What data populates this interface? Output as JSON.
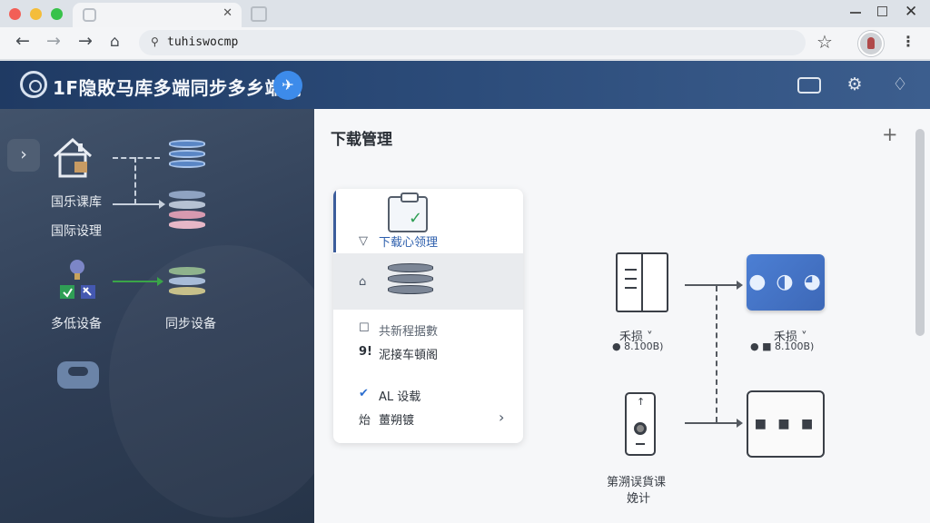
{
  "browser": {
    "url": "tuhiswocmp",
    "tab_close": "✕",
    "window_close": "✕"
  },
  "app": {
    "title": "1F隐敗马库多端同步多乡端同"
  },
  "sidebar": {
    "item1_label_a": "国乐课库",
    "item1_label_b": "国际设理",
    "item2_label": "多低设备",
    "item3_label": "同步设备"
  },
  "main": {
    "title": "下载管理",
    "card": {
      "row1_label": "下载心领理",
      "row3_label": "共新程据數",
      "row4_prefix": "9!",
      "row4_label": "泥接车頓阁",
      "row5_label": "AL 设载",
      "row6_prefix": "炲",
      "row6_label": "薑朔镀"
    },
    "diagram": {
      "node1_name": "禾损 ˅",
      "node1_size": "● 8.100B)",
      "node2_name": "禾损 ˅",
      "node2_size": "● ■ 8.100B)",
      "node3_label_a": "第溯误貨课",
      "node3_label_b": "娩计",
      "box_white_text": "■ ■ ■"
    }
  },
  "colors": {
    "header": "#2c4c7a",
    "sidebar": "#2f3e56",
    "accent": "#3d8bea",
    "blue_box": "#4c7fd4"
  },
  "icons": [
    "back-icon",
    "forward-icon",
    "refresh-icon",
    "home-icon",
    "star-icon",
    "gear-icon",
    "bell-icon",
    "screen-icon",
    "plus-icon",
    "chevron-right-icon"
  ]
}
